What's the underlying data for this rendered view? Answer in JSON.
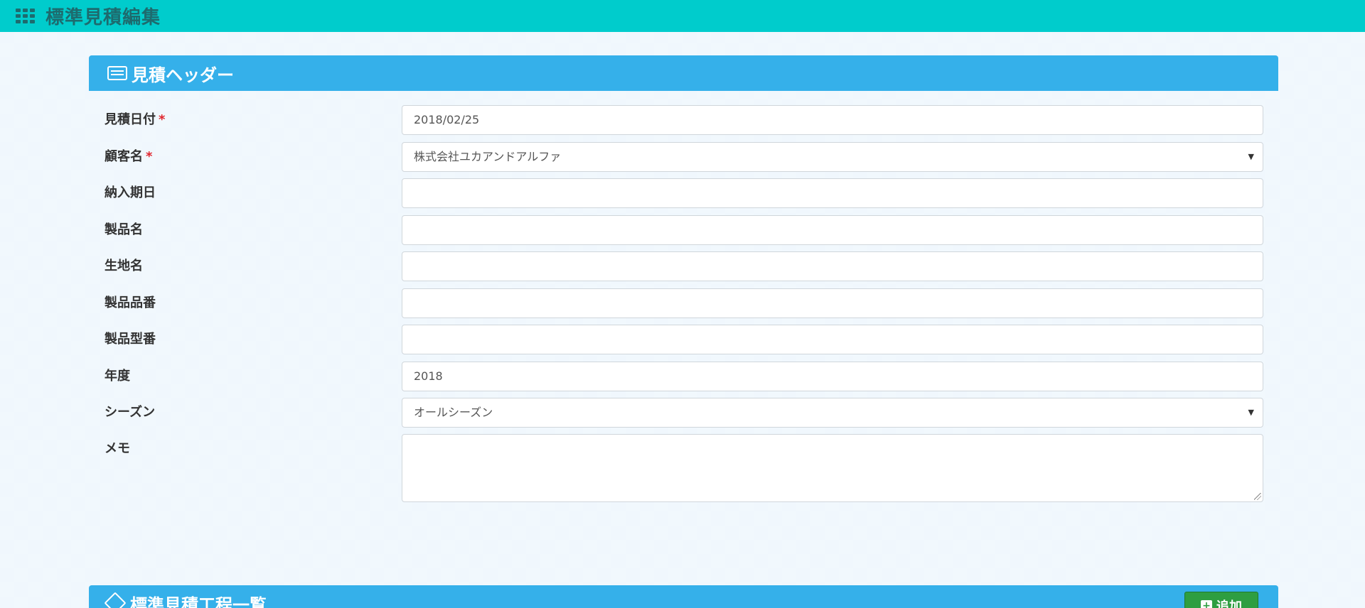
{
  "app": {
    "title": "標準見積編集"
  },
  "header_panel": {
    "title": "見積ヘッダー",
    "fields": [
      {
        "label": "見積日付",
        "required": true,
        "type": "input",
        "value": "2018/02/25"
      },
      {
        "label": "顧客名",
        "required": true,
        "type": "select",
        "value": "株式会社ユカアンドアルファ"
      },
      {
        "label": "納入期日",
        "required": false,
        "type": "input",
        "value": ""
      },
      {
        "label": "製品名",
        "required": false,
        "type": "input",
        "value": ""
      },
      {
        "label": "生地名",
        "required": false,
        "type": "input",
        "value": ""
      },
      {
        "label": "製品品番",
        "required": false,
        "type": "input",
        "value": ""
      },
      {
        "label": "製品型番",
        "required": false,
        "type": "input",
        "value": ""
      },
      {
        "label": "年度",
        "required": false,
        "type": "input",
        "value": "2018"
      },
      {
        "label": "シーズン",
        "required": false,
        "type": "select",
        "value": "オールシーズン"
      },
      {
        "label": "メモ",
        "required": false,
        "type": "textarea",
        "value": ""
      }
    ]
  },
  "process_panel": {
    "title": "標準見積工程一覧",
    "add_label": "追加"
  },
  "colors": {
    "topbar": "#00cccc",
    "panel_header": "#35b0ea",
    "add_button": "#2e9e41",
    "required_mark": "#e0262e"
  },
  "icons": {
    "app": "grid-icon",
    "header": "table-icon",
    "process": "cube-icon",
    "add": "plus-square-icon"
  }
}
